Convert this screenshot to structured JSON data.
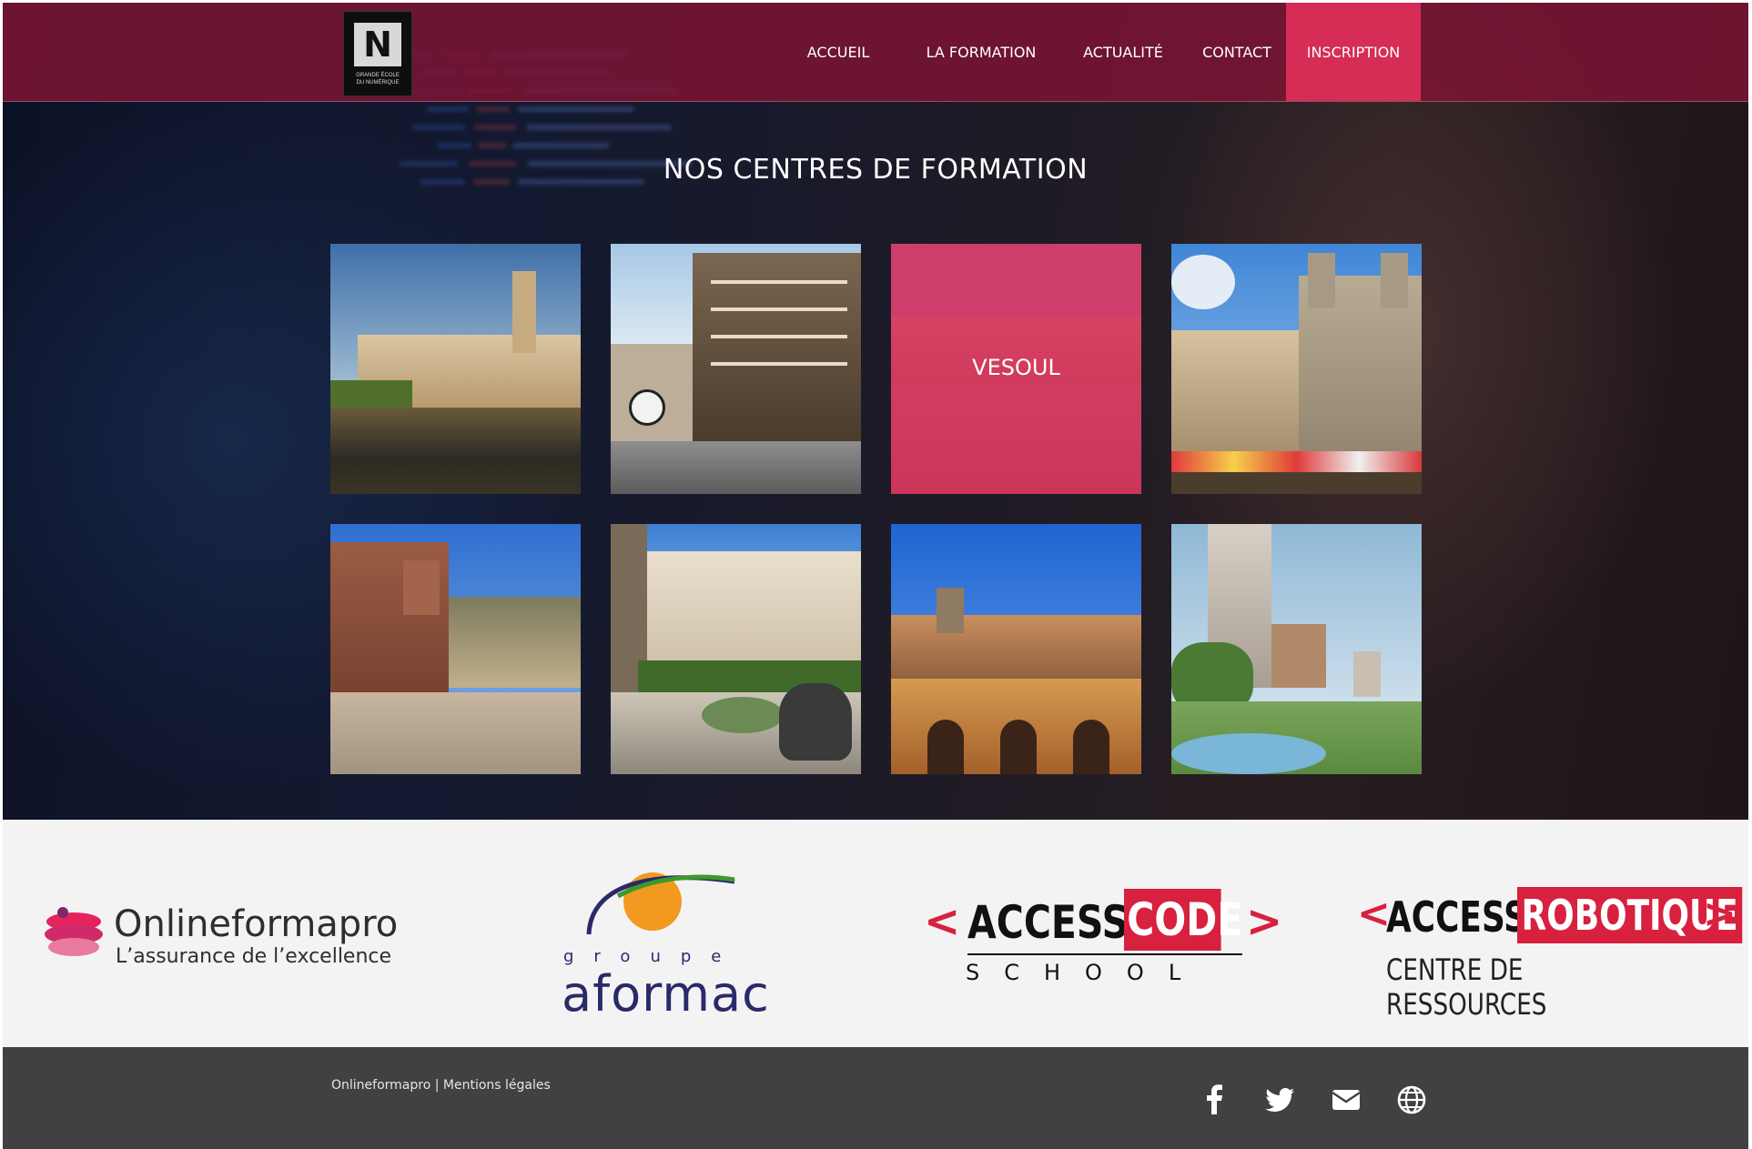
{
  "nav": {
    "logo_letter": "N",
    "logo_subtitle_line1": "GRANDE ÉCOLE",
    "logo_subtitle_line2": "DU NUMÉRIQUE",
    "items": [
      {
        "label": "ACCUEIL"
      },
      {
        "label": "LA FORMATION"
      },
      {
        "label": "ACTUALITÉ"
      },
      {
        "label": "CONTACT"
      },
      {
        "label": "INSCRIPTION",
        "active": true
      }
    ]
  },
  "hero": {
    "title": "NOS CENTRES DE FORMATION"
  },
  "centres": [
    {
      "label": "",
      "image": "besancon-river-photo"
    },
    {
      "label": "",
      "image": "dijon-timbered-houses-photo"
    },
    {
      "label": "VESOUL",
      "image": "vesoul-square-photo",
      "hovered": true
    },
    {
      "label": "",
      "image": "chalon-cathedral-photo"
    },
    {
      "label": "",
      "image": "belfort-place-photo"
    },
    {
      "label": "",
      "image": "lion-fountain-photo"
    },
    {
      "label": "",
      "image": "nevers-bridge-photo"
    },
    {
      "label": "",
      "image": "fountain-park-photo"
    }
  ],
  "partners": {
    "onlineformapro": {
      "name": "Onlineformapro",
      "tagline": "L’assurance de l’excellence"
    },
    "aformac": {
      "prefix": "groupe",
      "name": "aformac"
    },
    "accesscode": {
      "word1": "ACCESS",
      "word2": "CODE",
      "sub": "SCHOOL"
    },
    "accessrobotique": {
      "word1": "ACCESS",
      "word2": "ROBOTIQUE",
      "sub": "CENTRE DE RESSOURCES"
    }
  },
  "footer": {
    "brand_link": "Onlineformapro",
    "separator": "|",
    "legal_link": "Mentions légales",
    "social": [
      "facebook-icon",
      "twitter-icon",
      "envelope-icon",
      "globe-icon"
    ]
  },
  "colors": {
    "accent": "#d52d56",
    "navbar": "#801434",
    "footer": "#414141",
    "partners_bg": "#f3f3f3"
  }
}
